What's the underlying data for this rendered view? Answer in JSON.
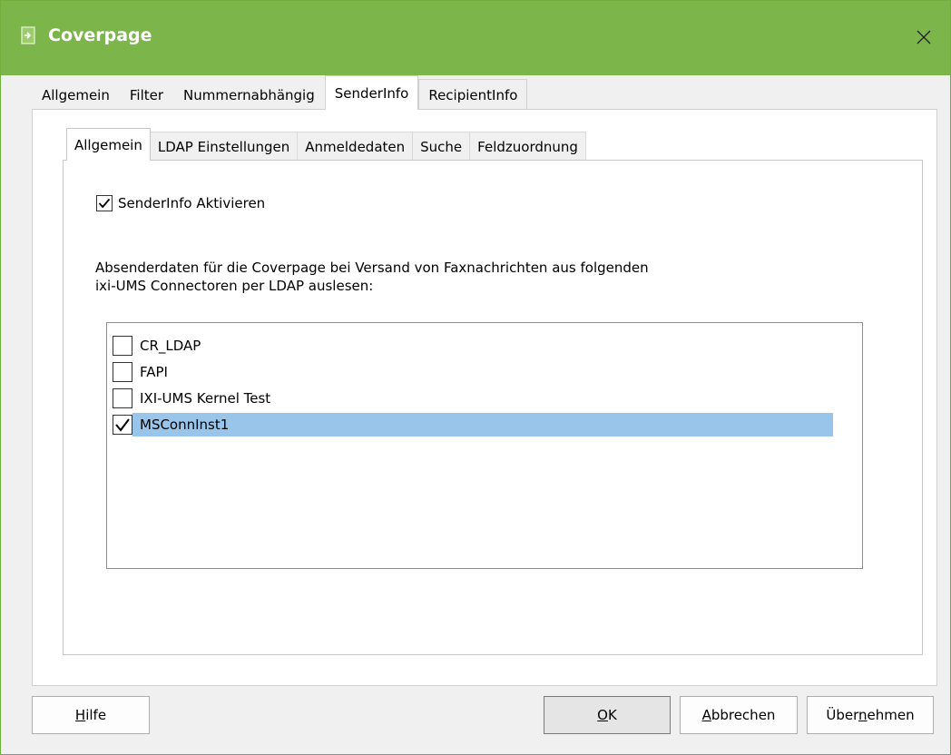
{
  "window": {
    "title": "Coverpage",
    "icon": "coverpage-app-icon",
    "close_icon": "close-icon"
  },
  "outer_tabs": [
    {
      "label": "Allgemein"
    },
    {
      "label": "Filter"
    },
    {
      "label": "Nummernabhängig"
    },
    {
      "label": "SenderInfo",
      "active": true
    },
    {
      "label": "RecipientInfo"
    }
  ],
  "inner_tabs": [
    {
      "label": "Allgemein",
      "active": true
    },
    {
      "label": "LDAP Einstellungen"
    },
    {
      "label": "Anmeldedaten"
    },
    {
      "label": "Suche"
    },
    {
      "label": "Feldzuordnung"
    }
  ],
  "senderinfo": {
    "enable_label": "SenderInfo Aktivieren",
    "enable_checked": true,
    "description_line1": "Absenderdaten für die Coverpage bei Versand von Faxnachrichten aus folgenden",
    "description_line2": "ixi-UMS Connectoren per LDAP auslesen:"
  },
  "connectors": [
    {
      "label": "CR_LDAP",
      "checked": false,
      "selected": false
    },
    {
      "label": "FAPI",
      "checked": false,
      "selected": false
    },
    {
      "label": "IXI-UMS Kernel Test",
      "checked": false,
      "selected": false
    },
    {
      "label": "MSConnInst1",
      "checked": true,
      "selected": true
    }
  ],
  "buttons": {
    "help_pre": "",
    "help_u": "H",
    "help_post": "ilfe",
    "ok_pre": "",
    "ok_u": "O",
    "ok_post": "K",
    "cancel_pre": "",
    "cancel_u": "A",
    "cancel_post": "bbrechen",
    "apply_pre": "Über",
    "apply_u": "n",
    "apply_post": "ehmen"
  },
  "colors": {
    "titlebar": "#7cb64a",
    "selection": "#99c5ea"
  }
}
